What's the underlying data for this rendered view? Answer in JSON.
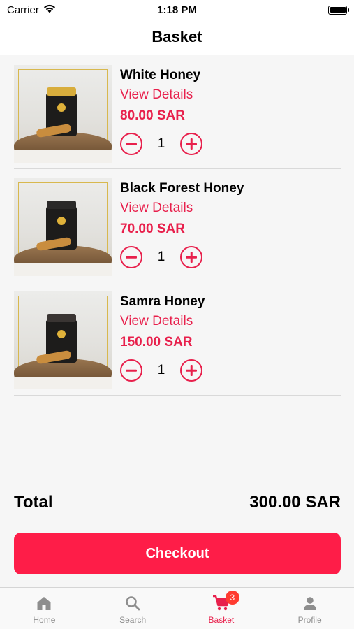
{
  "status_bar": {
    "carrier": "Carrier",
    "time": "1:18 PM"
  },
  "header": {
    "title": "Basket"
  },
  "items": [
    {
      "name": "White Honey",
      "details_label": "View Details",
      "price": "80.00 SAR",
      "quantity": "1",
      "lid_color": "#d8ad3c"
    },
    {
      "name": "Black Forest Honey",
      "details_label": "View Details",
      "price": "70.00 SAR",
      "quantity": "1",
      "lid_color": "#2a2928"
    },
    {
      "name": "Samra Honey",
      "details_label": "View Details",
      "price": "150.00 SAR",
      "quantity": "1",
      "lid_color": "#3a3533"
    }
  ],
  "summary": {
    "total_label": "Total",
    "total_value": "300.00 SAR"
  },
  "checkout_label": "Checkout",
  "tabbar": {
    "tabs": [
      {
        "label": "Home",
        "icon": "home-icon",
        "active": false
      },
      {
        "label": "Search",
        "icon": "search-icon",
        "active": false
      },
      {
        "label": "Basket",
        "icon": "cart-icon",
        "active": true,
        "badge": "3"
      },
      {
        "label": "Profile",
        "icon": "profile-icon",
        "active": false
      }
    ]
  },
  "colors": {
    "accent": "#e8204c",
    "checkout_bg": "#fe1d48",
    "badge": "#ff3b30"
  }
}
